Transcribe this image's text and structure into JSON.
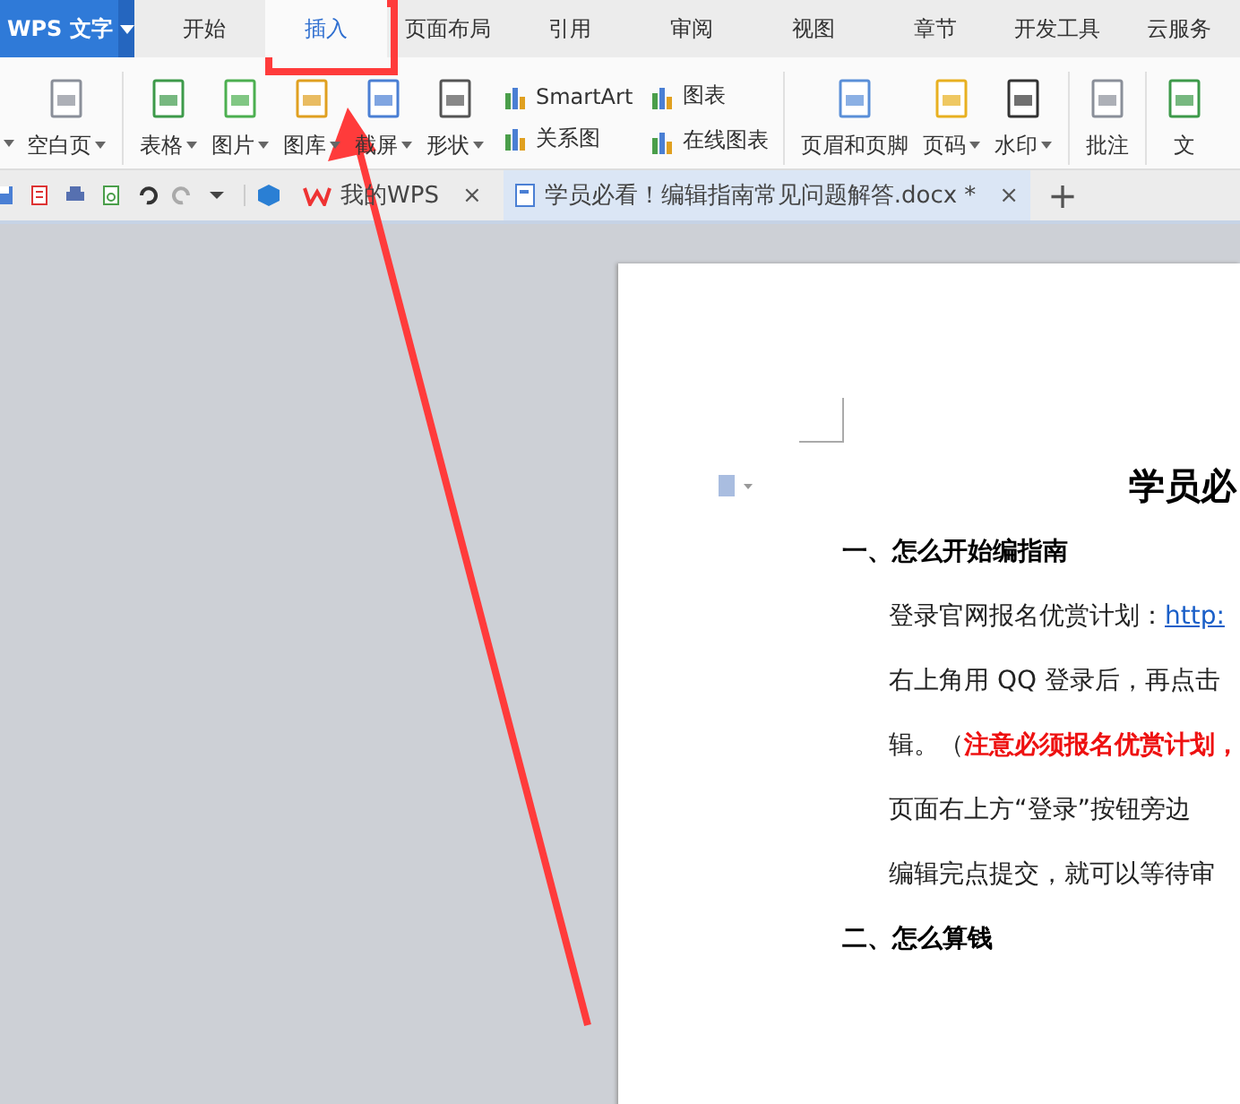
{
  "app_menu": {
    "label": "WPS 文字"
  },
  "menu_tabs": [
    {
      "label": "开始",
      "selected": false
    },
    {
      "label": "插入",
      "selected": true
    },
    {
      "label": "页面布局",
      "selected": false
    },
    {
      "label": "引用",
      "selected": false
    },
    {
      "label": "审阅",
      "selected": false
    },
    {
      "label": "视图",
      "selected": false
    },
    {
      "label": "章节",
      "selected": false
    },
    {
      "label": "开发工具",
      "selected": false
    },
    {
      "label": "云服务",
      "selected": false
    }
  ],
  "ribbon_groups": [
    {
      "items": [
        {
          "kind": "large",
          "label": "空白页",
          "dropdown": true
        }
      ]
    },
    {
      "items": [
        {
          "kind": "large",
          "label": "表格",
          "dropdown": true
        },
        {
          "kind": "large",
          "label": "图片",
          "dropdown": true
        },
        {
          "kind": "large",
          "label": "图库",
          "dropdown": true
        },
        {
          "kind": "large",
          "label": "截屏",
          "dropdown": true
        },
        {
          "kind": "large",
          "label": "形状",
          "dropdown": true
        },
        {
          "kind": "stack",
          "rows": [
            "SmartArt",
            "关系图"
          ]
        },
        {
          "kind": "stack",
          "rows": [
            "图表",
            "在线图表"
          ]
        }
      ]
    },
    {
      "items": [
        {
          "kind": "large",
          "label": "页眉和页脚",
          "dropdown": false
        },
        {
          "kind": "large",
          "label": "页码",
          "dropdown": true
        },
        {
          "kind": "large",
          "label": "水印",
          "dropdown": true
        }
      ]
    },
    {
      "items": [
        {
          "kind": "large",
          "label": "批注",
          "dropdown": false
        }
      ]
    },
    {
      "items": [
        {
          "kind": "large",
          "label": "文",
          "dropdown": false
        }
      ]
    }
  ],
  "doc_tabs": [
    {
      "label": "我的WPS",
      "selected": false,
      "close": "×"
    },
    {
      "label": "学员必看！编辑指南常见问题解答.docx *",
      "selected": true,
      "close": "×"
    }
  ],
  "new_tab": "+",
  "document": {
    "title": "学员必",
    "blocks": [
      {
        "kind": "heading",
        "text": "一、怎么开始编指南"
      },
      {
        "kind": "para",
        "runs": [
          {
            "text": "登录官网报名优赏计划：",
            "kind": "plain"
          },
          {
            "text": "http:",
            "kind": "link"
          }
        ]
      },
      {
        "kind": "para",
        "runs": [
          {
            "text": "右上角用 QQ 登录后，再点击",
            "kind": "plain"
          }
        ]
      },
      {
        "kind": "para",
        "runs": [
          {
            "text": "辑。（",
            "kind": "plain"
          },
          {
            "text": "注意必须报名优赏计划，",
            "kind": "emphasis"
          }
        ]
      },
      {
        "kind": "para",
        "runs": [
          {
            "text": "页面右上方“登录”按钮旁边",
            "kind": "plain"
          }
        ]
      },
      {
        "kind": "para",
        "runs": [
          {
            "text": "编辑完点提交，就可以等待审",
            "kind": "plain"
          }
        ]
      },
      {
        "kind": "heading",
        "text": "二、怎么算钱"
      }
    ]
  },
  "annotation": {
    "highlight": true,
    "arrow": true
  }
}
